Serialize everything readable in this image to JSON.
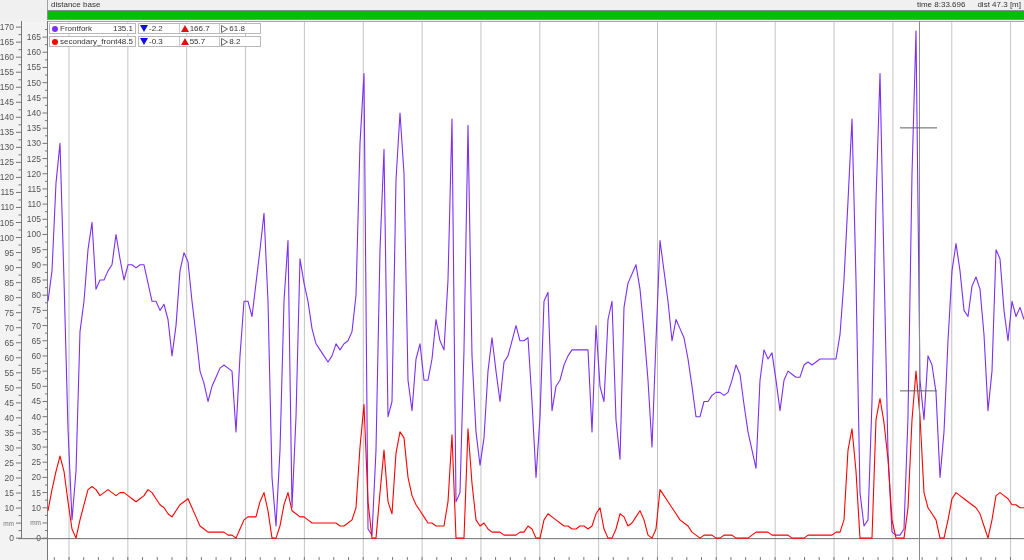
{
  "header": {
    "title": "distance base",
    "time": "time 8:33.696",
    "dist": "dist 47.3 [m]"
  },
  "secondary_axis": {
    "unit": "mm",
    "ticks": [
      "170",
      "165",
      "160",
      "155",
      "150",
      "145",
      "140",
      "135",
      "130",
      "125",
      "120",
      "115",
      "110",
      "105",
      "100",
      "95",
      "90",
      "85",
      "80",
      "75",
      "70",
      "65",
      "60",
      "55",
      "50",
      "45",
      "40",
      "35",
      "30",
      "25",
      "20",
      "15",
      "10",
      "0"
    ]
  },
  "readouts": [
    {
      "value": "135.1",
      "min": "-2.2",
      "max": "166.7",
      "avg": "61.8"
    },
    {
      "value": "48.5",
      "min": "-0.3",
      "max": "55.7",
      "avg": "8.2"
    }
  ],
  "chart_data": {
    "type": "line",
    "ylabel": "mm",
    "legend": "upper left",
    "ylim": [
      -7.2,
      170.3
    ],
    "yticks": [
      0,
      10,
      15,
      20,
      25,
      30,
      35,
      40,
      45,
      50,
      55,
      60,
      65,
      70,
      75,
      80,
      85,
      90,
      95,
      100,
      105,
      110,
      115,
      120,
      125,
      130,
      135,
      140,
      145,
      150,
      155,
      160,
      165
    ],
    "categories": [
      null,
      null,
      null,
      null,
      null,
      null,
      null,
      null,
      null,
      null,
      null,
      null,
      null,
      null,
      null,
      null,
      null,
      null,
      null,
      null,
      null,
      null,
      null,
      null,
      null,
      null,
      null,
      null,
      null,
      null,
      null,
      null,
      null,
      null,
      null,
      null,
      null,
      null,
      null,
      null,
      null,
      null,
      null,
      null,
      null,
      null,
      null,
      null,
      null,
      null,
      null,
      null,
      null,
      null,
      null,
      null,
      null,
      null,
      null,
      null,
      null,
      null,
      null,
      null,
      null,
      null,
      null,
      null,
      null,
      null,
      null,
      null,
      null,
      null,
      null,
      null,
      null,
      null,
      null,
      null,
      null,
      null,
      null,
      null,
      null,
      null,
      null,
      null,
      null,
      null,
      null,
      null,
      null,
      null,
      null,
      null,
      null,
      null,
      null,
      null,
      null,
      null,
      null,
      null,
      null,
      null,
      null,
      null,
      null,
      null,
      null,
      null,
      null,
      null,
      null,
      null,
      null,
      null,
      null,
      null,
      null,
      null,
      null,
      null,
      null,
      null,
      null,
      null,
      null,
      null,
      null,
      null,
      null,
      null,
      null,
      null,
      null,
      null,
      null,
      null,
      null,
      null,
      null,
      null,
      null,
      null,
      null,
      null,
      null,
      null,
      null,
      null,
      null,
      null,
      null,
      null,
      null,
      null,
      null,
      null,
      null,
      null,
      null,
      null,
      null,
      null,
      null,
      null,
      null,
      null,
      null,
      null,
      null,
      null,
      null,
      null,
      null,
      null,
      null,
      null,
      null,
      null,
      null,
      null,
      null,
      null,
      null,
      null,
      null,
      null,
      null,
      null,
      null,
      null,
      null,
      null,
      null,
      null,
      null,
      null,
      null,
      null,
      null,
      null,
      null,
      null,
      null,
      null,
      null,
      null,
      null,
      null,
      null,
      null,
      null,
      null,
      null,
      null,
      null,
      null,
      null,
      null,
      null,
      null,
      null,
      null,
      null,
      null,
      null,
      null,
      null,
      null,
      null,
      null,
      null,
      null,
      null,
      null,
      null,
      null,
      null,
      null,
      null,
      null,
      null
    ],
    "series": [
      {
        "name": "Frontfork",
        "color": "#7b2ff7",
        "values": [
          78,
          88,
          117,
          130,
          85,
          36,
          6,
          22,
          68,
          78,
          95,
          104,
          82,
          85,
          85,
          88,
          90,
          100,
          92,
          85,
          90,
          90,
          89,
          90,
          90,
          84,
          78,
          78,
          75,
          77,
          72,
          60,
          70,
          88,
          94,
          91,
          78,
          67,
          55,
          51,
          45,
          50,
          53,
          56,
          57,
          56,
          55,
          35,
          60,
          78,
          78,
          73,
          84,
          95,
          107,
          78,
          20,
          4,
          29,
          78,
          98,
          10,
          40,
          92,
          84,
          78,
          69,
          64,
          62,
          60,
          58,
          60,
          64,
          62,
          64,
          65,
          68,
          80,
          130,
          153,
          3,
          1,
          29,
          95,
          128,
          40,
          45,
          118,
          140,
          120,
          52,
          42,
          59,
          64,
          52,
          52,
          59,
          72,
          65,
          62,
          85,
          138,
          12,
          15,
          62,
          136,
          60,
          35,
          24,
          33,
          55,
          66,
          55,
          45,
          58,
          60,
          65,
          70,
          65,
          65,
          66,
          45,
          20,
          40,
          78,
          81,
          42,
          50,
          52,
          57,
          60,
          62,
          62,
          62,
          62,
          62,
          35,
          70,
          50,
          45,
          72,
          78,
          39,
          26,
          76,
          84,
          87,
          90,
          82,
          68,
          52,
          30,
          65,
          98,
          88,
          78,
          65,
          72,
          69,
          66,
          59,
          50,
          40,
          40,
          45,
          45,
          47,
          48,
          48,
          47,
          48,
          52,
          57,
          54,
          44,
          35,
          29,
          23,
          52,
          62,
          59,
          61,
          52,
          42,
          52,
          55,
          54,
          53,
          53,
          57,
          58,
          57,
          58,
          59,
          59,
          59,
          59,
          59,
          67,
          85,
          111,
          138,
          85,
          15,
          4,
          6,
          45,
          111,
          153,
          90,
          28,
          2,
          1,
          1,
          3,
          40,
          120,
          167,
          52,
          39,
          60,
          57,
          48,
          20,
          35,
          65,
          88,
          97,
          88,
          75,
          73,
          83,
          86,
          82,
          67,
          42,
          55,
          95,
          92,
          75,
          65,
          78,
          73,
          76,
          72
        ]
      },
      {
        "name": "secondary_front",
        "color": "#ff0000",
        "values": [
          9,
          16,
          22,
          27,
          22,
          12,
          3,
          0,
          6,
          11,
          16,
          17,
          16,
          14,
          15,
          16,
          15,
          14,
          15,
          15,
          14,
          13,
          12,
          13,
          14,
          16,
          15,
          13,
          11,
          10,
          8,
          7,
          9,
          11,
          12,
          13,
          10,
          7,
          4,
          3,
          2,
          2,
          2,
          2,
          2,
          1,
          1,
          0,
          3,
          6,
          7,
          7,
          7,
          12,
          15,
          9,
          0,
          0,
          4,
          11,
          15,
          9,
          8,
          7,
          7,
          6,
          5,
          5,
          5,
          5,
          5,
          5,
          5,
          4,
          4,
          5,
          6,
          10,
          30,
          44,
          12,
          0,
          0,
          15,
          29,
          12,
          8,
          28,
          35,
          33,
          20,
          14,
          11,
          9,
          7,
          5,
          5,
          4,
          4,
          4,
          12,
          34,
          0,
          0,
          0,
          36,
          18,
          6,
          4,
          5,
          3,
          2,
          2,
          2,
          1,
          1,
          1,
          1,
          2,
          2,
          4,
          3,
          0,
          0,
          6,
          8,
          7,
          6,
          5,
          4,
          4,
          3,
          3,
          4,
          4,
          3,
          4,
          8,
          10,
          3,
          0,
          0,
          3,
          8,
          7,
          4,
          5,
          7,
          9,
          6,
          1,
          0,
          3,
          16,
          14,
          12,
          10,
          8,
          6,
          5,
          4,
          2,
          1,
          0,
          1,
          1,
          1,
          0,
          0,
          1,
          1,
          1,
          0,
          0,
          0,
          0,
          1,
          2,
          2,
          2,
          2,
          1,
          1,
          1,
          1,
          1,
          0,
          0,
          0,
          0,
          1,
          1,
          1,
          1,
          1,
          1,
          1,
          2,
          2,
          6,
          29,
          36,
          22,
          0,
          0,
          0,
          0,
          39,
          46,
          38,
          26,
          6,
          0,
          0,
          0,
          10,
          39,
          55,
          40,
          15,
          10,
          8,
          6,
          0,
          0,
          6,
          13,
          15,
          14,
          13,
          12,
          11,
          10,
          8,
          4,
          0,
          6,
          14,
          15,
          14,
          13,
          11,
          11,
          10,
          10
        ]
      }
    ]
  }
}
